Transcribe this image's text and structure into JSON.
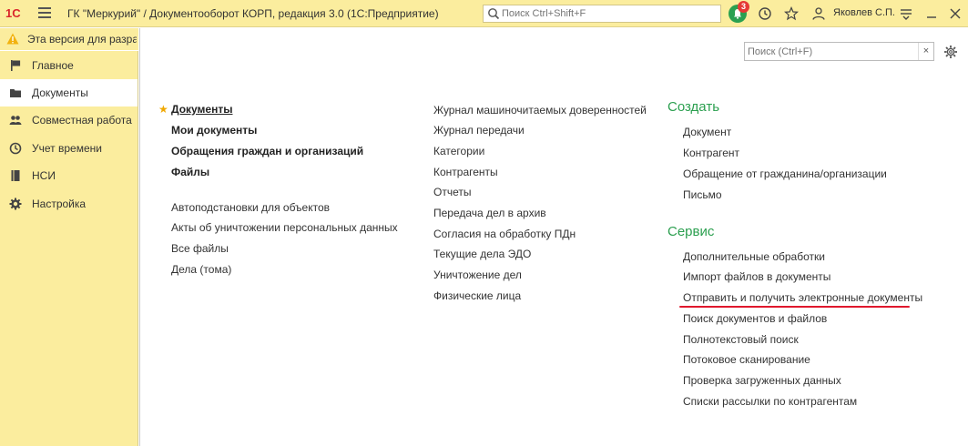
{
  "topbar": {
    "logo": "1С",
    "title": "ГК \"Меркурий\" / Документооборот КОРП, редакция 3.0  (1С:Предприятие)",
    "search_placeholder": "Поиск Ctrl+Shift+F",
    "notification_count": "3",
    "user": "Яковлев С.П."
  },
  "warning": {
    "text": "Эта версия для разрабо"
  },
  "sidebar": {
    "items": [
      {
        "label": "Главное",
        "icon": "flag-icon"
      },
      {
        "label": "Документы",
        "icon": "folder-icon"
      },
      {
        "label": "Совместная работа",
        "icon": "people-icon"
      },
      {
        "label": "Учет времени",
        "icon": "clock-icon"
      },
      {
        "label": "НСИ",
        "icon": "book-icon"
      },
      {
        "label": "Настройка",
        "icon": "gear-icon"
      }
    ],
    "active_index": 1
  },
  "main": {
    "search_placeholder": "Поиск (Ctrl+F)",
    "clear": "×",
    "col1_bold": [
      "Документы",
      "Мои документы",
      "Обращения граждан и организаций",
      "Файлы"
    ],
    "col1_links": [
      "Автоподстановки для объектов",
      "Акты об уничтожении персональных данных",
      "Все файлы",
      "Дела (тома)"
    ],
    "col2_links": [
      "Журнал машиночитаемых доверенностей",
      "Журнал передачи",
      "Категории",
      "Контрагенты",
      "Отчеты",
      "Передача дел в архив",
      "Согласия на обработку ПДн",
      "Текущие дела ЭДО",
      "Уничтожение дел",
      "Физические лица"
    ],
    "create_title": "Создать",
    "create_links": [
      "Документ",
      "Контрагент",
      "Обращение от гражданина/организации",
      "Письмо"
    ],
    "service_title": "Сервис",
    "service_links": [
      "Дополнительные обработки",
      "Импорт файлов в документы",
      "Отправить и получить электронные документы",
      "Поиск документов и файлов",
      "Полнотекстовый поиск",
      "Потоковое сканирование",
      "Проверка загруженных данных",
      "Списки рассылки по контрагентам"
    ]
  },
  "colors": {
    "panel": "#fbed9e",
    "section": "#2b9f4f",
    "highlight": "#e0182d"
  }
}
